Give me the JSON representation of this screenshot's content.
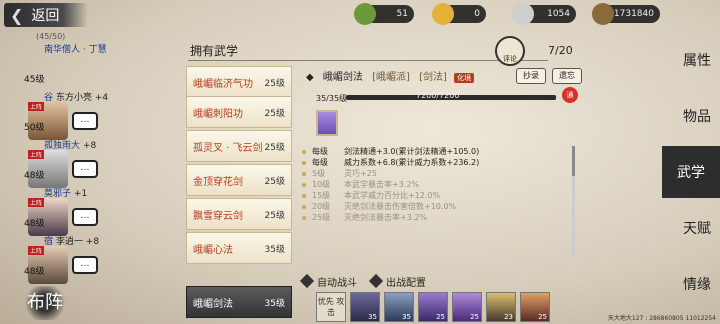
{
  "top": {
    "back_label": "返回",
    "resources": [
      {
        "name": "jade-ticket",
        "value": "51",
        "color": "#6b9a3a"
      },
      {
        "name": "gold-bar",
        "value": "0",
        "color": "#e4b23a"
      },
      {
        "name": "silver-ingot",
        "value": "1054",
        "color": "#cfcfcf"
      },
      {
        "name": "copper-coin",
        "value": "1731840",
        "color": "#8a6a3a"
      }
    ]
  },
  "roster": {
    "count": "(45/50)",
    "characters": [
      {
        "name": "南华僧人 · 丁慧",
        "plus": "",
        "level": "45级",
        "badge": "",
        "bubble": ""
      },
      {
        "name": "谷",
        "plus": "东方小亮 +4",
        "level": "50级",
        "badge": "上阵",
        "bubble": "…"
      },
      {
        "name": "孤独雨大",
        "plus": "+8",
        "level": "48级",
        "badge": "上阵",
        "bubble": "…"
      },
      {
        "name": "莫邪子",
        "plus": "+1",
        "level": "48级",
        "badge": "上阵",
        "bubble": "…"
      },
      {
        "name": "宿",
        "plus": "李逍一 +8",
        "level": "48级",
        "badge": "上阵",
        "bubble": "…"
      }
    ],
    "formation_label": "布阵"
  },
  "panel": {
    "title": "拥有武学",
    "page": "7/20",
    "comment_label": "评论",
    "skills": [
      {
        "name": "峨嵋临济气功",
        "level": "25级"
      },
      {
        "name": "峨嵋刺阳功",
        "level": "25级"
      },
      {
        "name": "孤灵叉 · 飞云剑",
        "level": "25级"
      },
      {
        "name": "金顶穿花剑",
        "level": "25级"
      },
      {
        "name": "飘雪穿云剑",
        "level": "25级"
      },
      {
        "name": "峨嵋心法",
        "level": "35级"
      },
      {
        "name": "峨嵋剑法",
        "level": "35级"
      }
    ],
    "detail": {
      "name": "峨嵋剑法",
      "sect": "[峨嵋派]",
      "type": "[剑法]",
      "tag": "化境",
      "copy_label": "抄录",
      "forget_label": "遗忘",
      "level_label": "35/35级",
      "progress": 1.0,
      "progress_text": "7200/7200",
      "tong_label": "通",
      "stats": [
        {
          "lv": "每级",
          "text": "剑法精通+3.0(累计剑法精通+105.0)",
          "dim": false
        },
        {
          "lv": "每级",
          "text": "威力系数+6.8(累计威力系数+236.2)",
          "dim": false
        },
        {
          "lv": "5级",
          "text": "灵巧+25",
          "dim": true
        },
        {
          "lv": "10级",
          "text": "本武学暴击率+3.2%",
          "dim": true
        },
        {
          "lv": "15级",
          "text": "本武学威力百分比+12.0%",
          "dim": true
        },
        {
          "lv": "20级",
          "text": "灭绝剑法暴击伤害倍数+10.0%",
          "dim": true
        },
        {
          "lv": "25级",
          "text": "灭绝剑法暴击率+3.2%",
          "dim": true
        }
      ],
      "auto_battle": "自动战斗",
      "battle_config": "出战配置",
      "priority_label": "优先\n攻击",
      "slot_levels": [
        "35",
        "35",
        "25",
        "25",
        "23",
        "25"
      ]
    }
  },
  "menu": {
    "items": [
      "属性",
      "物品",
      "武学",
      "天赋",
      "情缘"
    ],
    "active": "武学"
  },
  "footer": "天大地大127 : 286860805 11012254"
}
